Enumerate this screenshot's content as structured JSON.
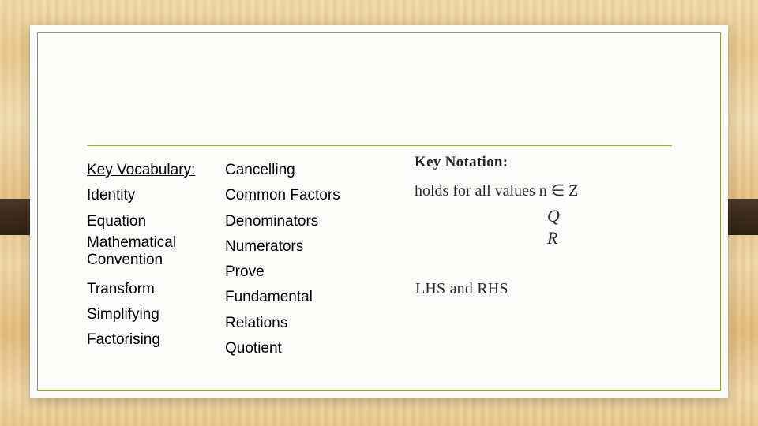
{
  "slide": {
    "vocabulary": {
      "heading": "Key Vocabulary:",
      "column_left": [
        "Identity",
        "Equation",
        "Mathematical Convention",
        "Transform",
        "Simplifying",
        "Factorising"
      ],
      "column_left_multiline": {
        "line1": "Mathematical",
        "line2": "Convention"
      },
      "column_right": [
        "Cancelling",
        "Common Factors",
        "Denominators",
        "Numerators",
        "Prove",
        "Fundamental",
        "Relations",
        "Quotient"
      ]
    },
    "notation": {
      "title": "Key Notation:",
      "holds_line": "holds for all values n ∈ Z",
      "symbol_q": "Q",
      "symbol_r": "R",
      "lhs_rhs": "LHS and RHS"
    },
    "colors": {
      "border_green": "#8aa03c",
      "rule_green": "#97ae4e",
      "page_background": "#fbfbf9",
      "text": "#000000",
      "desk_wood": "#e8c88a"
    }
  }
}
